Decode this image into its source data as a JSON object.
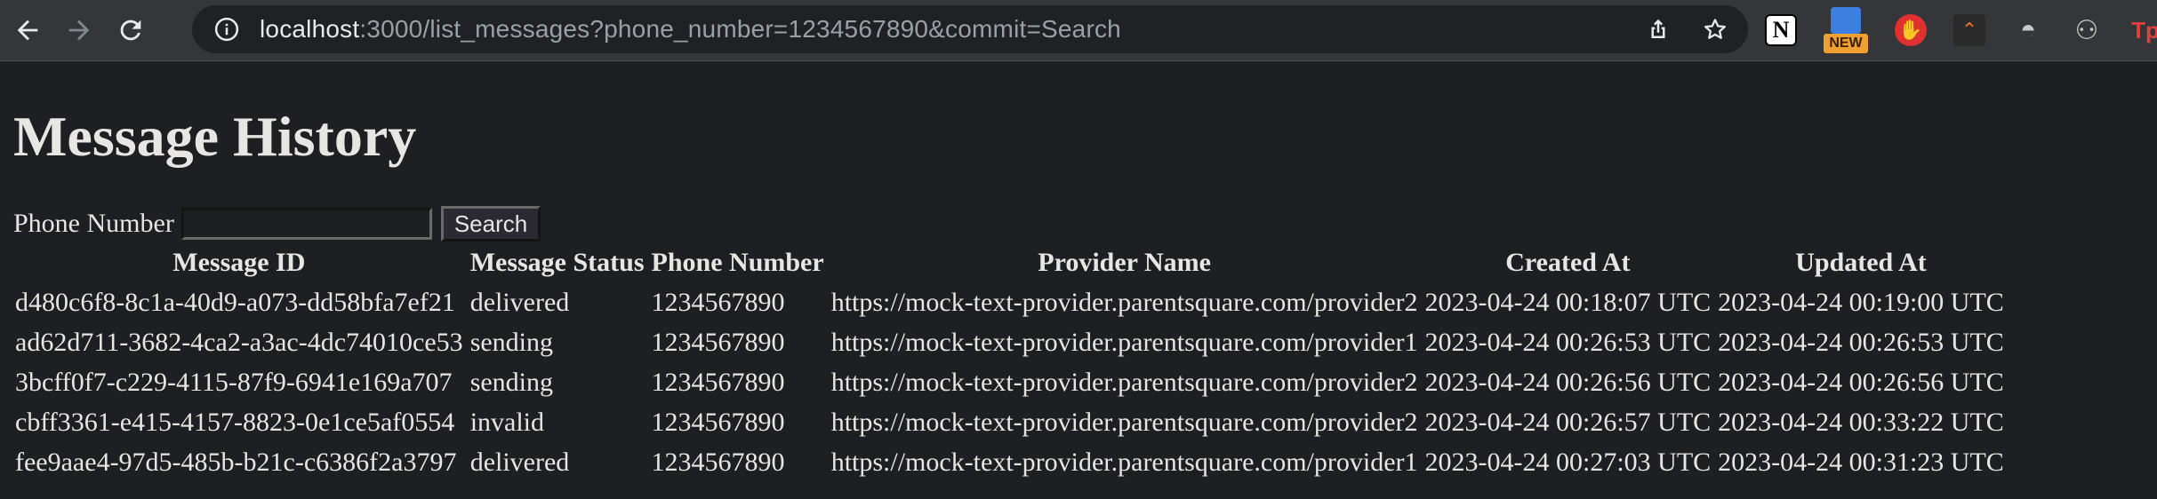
{
  "browser": {
    "url_host": "localhost",
    "url_rest": ":3000/list_messages?phone_number=1234567890&commit=Search",
    "extensions": {
      "notion_letter": "N",
      "new_badge": "NEW",
      "tp_label": "Tp"
    }
  },
  "page": {
    "title": "Message History",
    "search": {
      "label": "Phone Number",
      "value": "",
      "button": "Search"
    },
    "table": {
      "headers": [
        "Message ID",
        "Message Status",
        "Phone Number",
        "Provider Name",
        "Created At",
        "Updated At"
      ],
      "rows": [
        [
          "d480c6f8-8c1a-40d9-a073-dd58bfa7ef21",
          "delivered",
          "1234567890",
          "https://mock-text-provider.parentsquare.com/provider2",
          "2023-04-24 00:18:07 UTC",
          "2023-04-24 00:19:00 UTC"
        ],
        [
          "ad62d711-3682-4ca2-a3ac-4dc74010ce53",
          "sending",
          "1234567890",
          "https://mock-text-provider.parentsquare.com/provider1",
          "2023-04-24 00:26:53 UTC",
          "2023-04-24 00:26:53 UTC"
        ],
        [
          "3bcff0f7-c229-4115-87f9-6941e169a707",
          "sending",
          "1234567890",
          "https://mock-text-provider.parentsquare.com/provider2",
          "2023-04-24 00:26:56 UTC",
          "2023-04-24 00:26:56 UTC"
        ],
        [
          "cbff3361-e415-4157-8823-0e1ce5af0554",
          "invalid",
          "1234567890",
          "https://mock-text-provider.parentsquare.com/provider2",
          "2023-04-24 00:26:57 UTC",
          "2023-04-24 00:33:22 UTC"
        ],
        [
          "fee9aae4-97d5-485b-b21c-c6386f2a3797",
          "delivered",
          "1234567890",
          "https://mock-text-provider.parentsquare.com/provider1",
          "2023-04-24 00:27:03 UTC",
          "2023-04-24 00:31:23 UTC"
        ]
      ]
    }
  }
}
